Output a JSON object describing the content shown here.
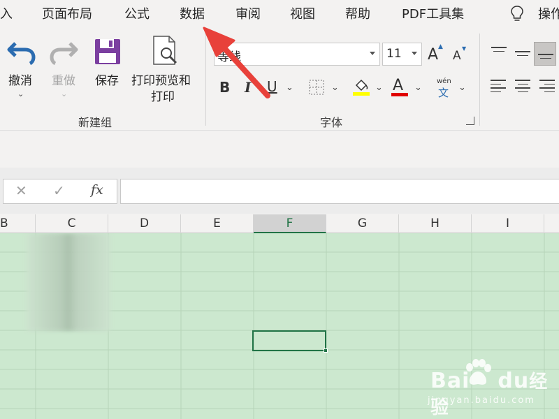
{
  "tabs": [
    "入",
    "页面布局",
    "公式",
    "数据",
    "审阅",
    "视图",
    "帮助",
    "PDF工具集",
    "操作"
  ],
  "group_new": {
    "label": "新建组",
    "undo_label": "撤消",
    "redo_label": "重做",
    "save_label": "保存",
    "print_preview_label_1": "打印预览和",
    "print_preview_label_2": "打印"
  },
  "group_font": {
    "label": "字体",
    "font_name": "等线",
    "font_size": "11",
    "bold": "B",
    "italic": "I",
    "underline": "U",
    "grow": "A",
    "shrink": "A",
    "font_color": "A",
    "phonetic_top": "wén",
    "phonetic_bottom": "文"
  },
  "formula_bar": {
    "cancel": "✕",
    "enter": "✓",
    "fx": "fx",
    "value": ""
  },
  "columns": [
    "B",
    "C",
    "D",
    "E",
    "F",
    "G",
    "H",
    "I"
  ],
  "active_column": "F",
  "watermark": {
    "brand": "Bai",
    "brand2": "du",
    "suffix": "经验",
    "url": "jingyan.baidu.com"
  },
  "colors": {
    "excel_green": "#217346",
    "grid_bg": "#cce8cf",
    "arrow_red": "#e8413a"
  },
  "icons": [
    "undo-icon",
    "redo-icon",
    "save-icon",
    "print-preview-icon",
    "lightbulb-icon",
    "borders-icon",
    "fill-color-icon",
    "align-top-icon",
    "align-middle-icon",
    "align-bottom-icon",
    "align-left-icon",
    "align-center-icon",
    "align-right-icon"
  ]
}
